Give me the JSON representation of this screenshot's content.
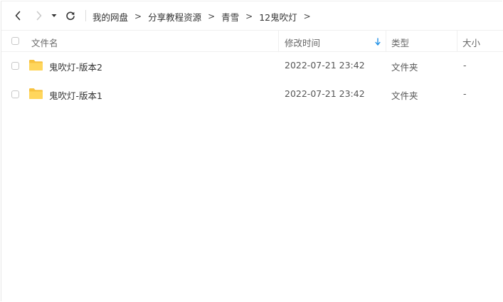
{
  "nav": {
    "back_icon": "chevron-left-icon",
    "forward_icon": "chevron-right-icon",
    "dropdown_icon": "caret-down-icon",
    "refresh_icon": "refresh-icon",
    "breadcrumb": [
      "我的网盘",
      "分享教程资源",
      "青雪",
      "12鬼吹灯"
    ],
    "separator": ">"
  },
  "table": {
    "headers": {
      "name": "文件名",
      "modified": "修改时间",
      "type": "类型",
      "size": "大小"
    },
    "sort_icon": "sort-down-arrow-icon",
    "rows": [
      {
        "name": "鬼吹灯-版本2",
        "modified": "2022-07-21 23:42",
        "type": "文件夹",
        "size": "-",
        "icon": "folder-icon"
      },
      {
        "name": "鬼吹灯-版本1",
        "modified": "2022-07-21 23:42",
        "type": "文件夹",
        "size": "-",
        "icon": "folder-icon"
      }
    ]
  },
  "colors": {
    "folder": "#FFD65C",
    "folder_tab": "#F7C23F",
    "sort_arrow": "#1E90E6",
    "disabled": "#c9c9c9"
  }
}
